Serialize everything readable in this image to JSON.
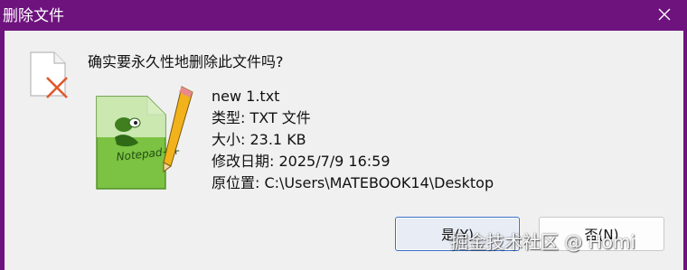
{
  "window": {
    "title": "删除文件",
    "title_bar_color": "#6e137e",
    "close_icon": "close-icon"
  },
  "dialog": {
    "question": "确实要永久性地删除此文件吗?",
    "warning_icon": "document-delete-icon",
    "file_icon": "notepad-plus-plus-file-icon",
    "file": {
      "name": "new 1.txt",
      "type": "类型: TXT 文件",
      "size": "大小: 23.1 KB",
      "modified": "修改日期: 2025/7/9 16:59",
      "location": "原位置: C:\\Users\\MATEBOOK14\\Desktop"
    },
    "buttons": {
      "yes": "是(Y)",
      "no": "否(N)"
    }
  },
  "watermark": "掘金技术社区 @ Homi"
}
